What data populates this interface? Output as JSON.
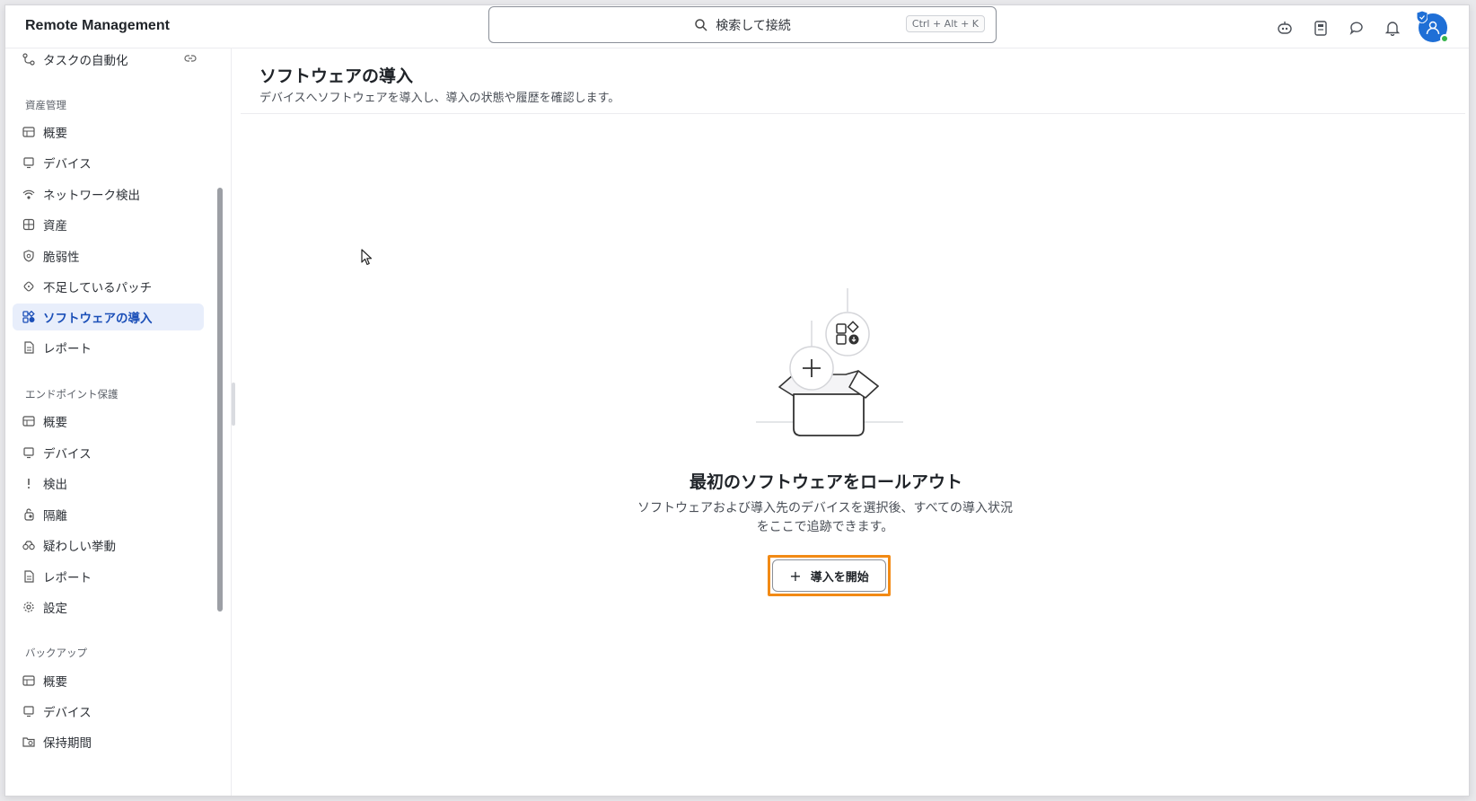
{
  "app": {
    "title": "Remote Management"
  },
  "search": {
    "placeholder": "検索して接続",
    "shortcut": "Ctrl + Alt + K"
  },
  "topbar_icons": [
    "robot-assistant-icon",
    "clipboard-icon",
    "chat-icon",
    "bell-icon",
    "user-avatar"
  ],
  "sidebar": {
    "top_item": {
      "label": "タスクの自動化",
      "icon": "automation-icon"
    },
    "sections": [
      {
        "label": "資産管理",
        "items": [
          {
            "label": "概要",
            "icon": "dashboard-icon"
          },
          {
            "label": "デバイス",
            "icon": "monitor-icon"
          },
          {
            "label": "ネットワーク検出",
            "icon": "network-icon"
          },
          {
            "label": "資産",
            "icon": "grid-icon"
          },
          {
            "label": "脆弱性",
            "icon": "shield-search-icon"
          },
          {
            "label": "不足しているパッチ",
            "icon": "patch-icon"
          },
          {
            "label": "ソフトウェアの導入",
            "icon": "software-deploy-icon",
            "active": true
          },
          {
            "label": "レポート",
            "icon": "report-icon"
          }
        ]
      },
      {
        "label": "エンドポイント保護",
        "items": [
          {
            "label": "概要",
            "icon": "dashboard-icon"
          },
          {
            "label": "デバイス",
            "icon": "monitor-icon"
          },
          {
            "label": "検出",
            "icon": "alert-icon"
          },
          {
            "label": "隔離",
            "icon": "quarantine-icon"
          },
          {
            "label": "疑わしい挙動",
            "icon": "binoculars-icon"
          },
          {
            "label": "レポート",
            "icon": "report-icon"
          },
          {
            "label": "設定",
            "icon": "gear-icon"
          }
        ]
      },
      {
        "label": "バックアップ",
        "items": [
          {
            "label": "概要",
            "icon": "dashboard-icon"
          },
          {
            "label": "デバイス",
            "icon": "monitor-icon"
          },
          {
            "label": "保持期間",
            "icon": "folder-clock-icon"
          }
        ]
      }
    ]
  },
  "main": {
    "title": "ソフトウェアの導入",
    "subtitle": "デバイスへソフトウェアを導入し、導入の状態や履歴を確認します。",
    "empty_state": {
      "title": "最初のソフトウェアをロールアウト",
      "description": "ソフトウェアおよび導入先のデバイスを選択後、すべての導入状況をここで追跡できます。",
      "button_label": "導入を開始"
    }
  },
  "colors": {
    "accent": "#1f6fd6",
    "active_bg": "#e8eefb",
    "highlight": "#f28a15"
  }
}
